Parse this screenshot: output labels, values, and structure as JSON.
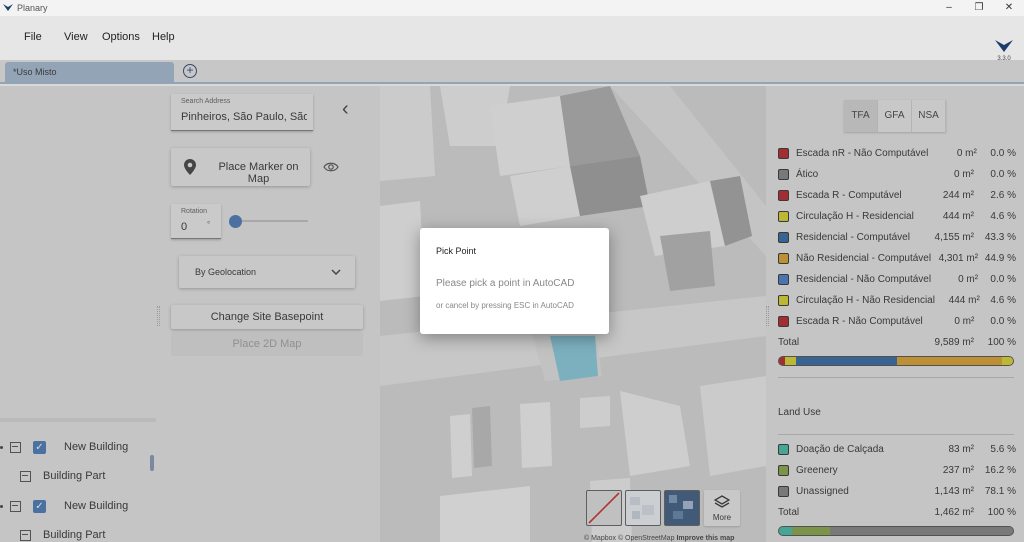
{
  "window": {
    "title": "Planary",
    "minimize": "–",
    "restore": "❐",
    "close": "✕"
  },
  "menu": {
    "items": [
      "File",
      "View",
      "Options",
      "Help"
    ],
    "version": "3.3.0"
  },
  "tabs": {
    "active": "*Uso Misto",
    "add": "+"
  },
  "tree": {
    "rows": [
      {
        "label": "New Building",
        "type": "building",
        "checked": true
      },
      {
        "label": "Building Part",
        "type": "part"
      },
      {
        "label": "New Building",
        "type": "building",
        "checked": true
      },
      {
        "label": "Building Part",
        "type": "part"
      }
    ]
  },
  "site": {
    "search_label": "Search Address",
    "search_value": "Pinheiros, São Paulo, São P",
    "back": "‹",
    "place_marker": "Place Marker on Map",
    "rotation_label": "Rotation",
    "rotation_value": "0",
    "rotation_unit": "°",
    "rotation_level": 0,
    "geolocation": "By Geolocation",
    "change_basepoint": "Change Site Basepoint",
    "place_2d_map": "Place 2D Map"
  },
  "map": {
    "more": "More",
    "attribution": "© Mapbox © OpenStreetMap",
    "improve": "Improve this map"
  },
  "area_panel": {
    "toggles": [
      "TFA",
      "GFA",
      "NSA"
    ],
    "active_toggle": "TFA",
    "rows": [
      {
        "label": "Escada nR - Não Computável",
        "area": "0 m²",
        "pct": "0.0 %",
        "color": "#b3121b"
      },
      {
        "label": "Ático",
        "area": "0 m²",
        "pct": "0.0 %",
        "color": "#7a7a7a"
      },
      {
        "label": "Escada R - Computável",
        "area": "244 m²",
        "pct": "2.6 %",
        "color": "#b3121b"
      },
      {
        "label": "Circulação H - Residencial",
        "area": "444 m²",
        "pct": "4.6 %",
        "color": "#d8d21a"
      },
      {
        "label": "Residencial - Computável",
        "area": "4,155 m²",
        "pct": "43.3 %",
        "color": "#1f5e9c"
      },
      {
        "label": "Não Residencial - Computável",
        "area": "4,301 m²",
        "pct": "44.9 %",
        "color": "#d89a1c"
      },
      {
        "label": "Residencial - Não Computável",
        "area": "0 m²",
        "pct": "0.0 %",
        "color": "#3a74c4"
      },
      {
        "label": "Circulação H - Não Residencial",
        "area": "444 m²",
        "pct": "4.6 %",
        "color": "#d8d21a"
      },
      {
        "label": "Escada R - Não Computável",
        "area": "0 m²",
        "pct": "0.0 %",
        "color": "#b3121b"
      }
    ],
    "total_label": "Total",
    "total_area": "9,589 m²",
    "total_pct": "100 %",
    "bar": [
      {
        "color": "#b3121b",
        "pct": 2.6
      },
      {
        "color": "#d8d21a",
        "pct": 4.6
      },
      {
        "color": "#1f5e9c",
        "pct": 43.3
      },
      {
        "color": "#d89a1c",
        "pct": 44.9
      },
      {
        "color": "#d8d21a",
        "pct": 4.6
      }
    ]
  },
  "land_use": {
    "title": "Land Use",
    "rows": [
      {
        "label": "Doação de Calçada",
        "area": "83 m²",
        "pct": "5.6 %",
        "color": "#34b8a0"
      },
      {
        "label": "Greenery",
        "area": "237 m²",
        "pct": "16.2 %",
        "color": "#7da03a"
      },
      {
        "label": "Unassigned",
        "area": "1,143 m²",
        "pct": "78.1 %",
        "color": "#7a7a7a"
      }
    ],
    "total_label": "Total",
    "total_area": "1,462 m²",
    "total_pct": "100 %",
    "bar": [
      {
        "color": "#34b8a0",
        "pct": 5.6
      },
      {
        "color": "#7da03a",
        "pct": 16.2
      },
      {
        "color": "#7a7a7a",
        "pct": 78.1
      }
    ]
  },
  "dialog": {
    "title": "Pick Point",
    "message": "Please pick a point in AutoCAD",
    "sub": "or cancel by pressing ESC in AutoCAD"
  }
}
